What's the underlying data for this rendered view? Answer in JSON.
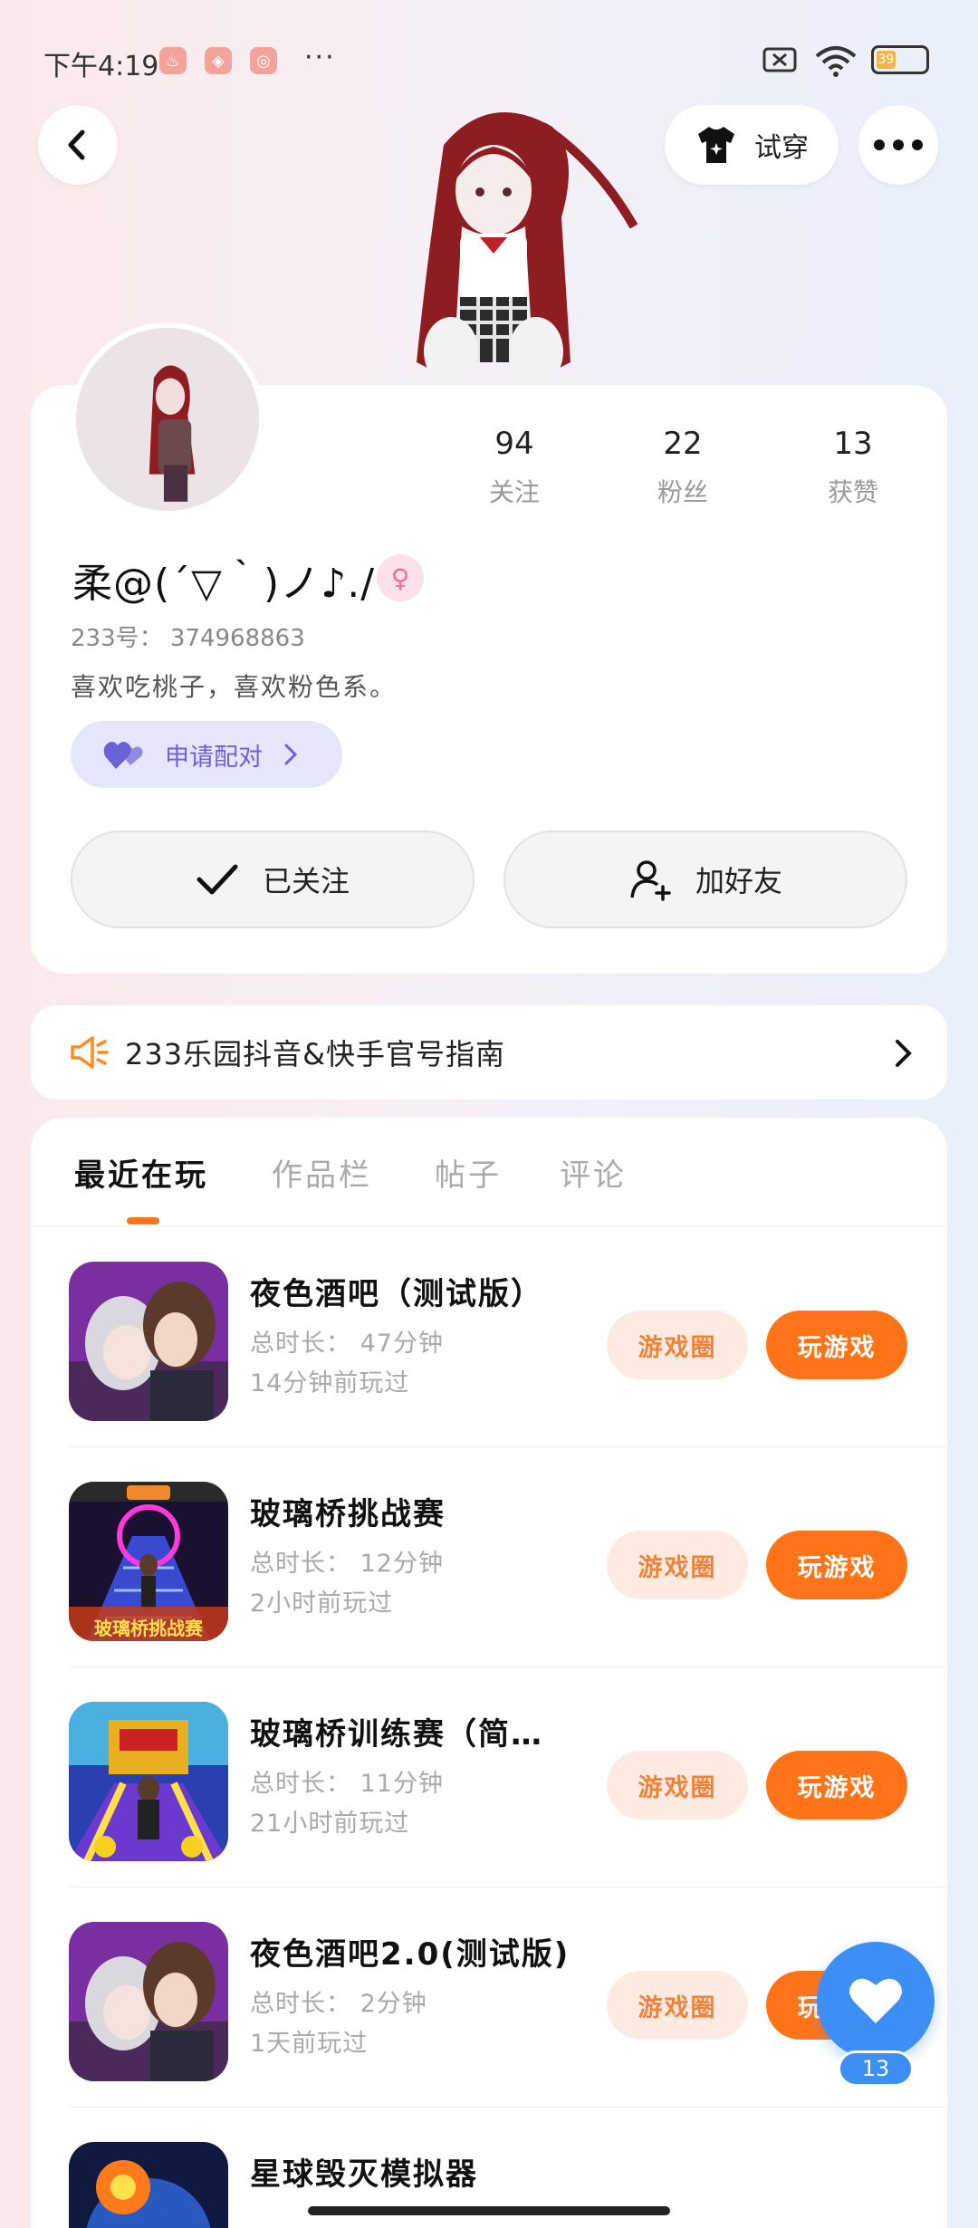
{
  "status_bar": {
    "time": "下午4:19",
    "more": "···",
    "battery": "39",
    "wifi_label": "6"
  },
  "topbar": {
    "tryon_label": "试穿"
  },
  "profile": {
    "nickname": "柔@(´▽｀)ノ♪./",
    "gender_symbol": "♀",
    "uid": "233号： 374968863",
    "bio": "喜欢吃桃子，喜欢粉色系。",
    "pair_label": "申请配对",
    "stats": [
      {
        "value": "94",
        "label": "关注"
      },
      {
        "value": "22",
        "label": "粉丝"
      },
      {
        "value": "13",
        "label": "获赞"
      }
    ],
    "followed_label": "已关注",
    "add_friend_label": "加好友"
  },
  "notice": {
    "text": "233乐园抖音&快手官号指南"
  },
  "tabs": [
    {
      "label": "最近在玩",
      "active": true
    },
    {
      "label": "作品栏",
      "active": false
    },
    {
      "label": "帖子",
      "active": false
    },
    {
      "label": "评论",
      "active": false
    }
  ],
  "games": [
    {
      "name": "夜色酒吧（测试版）",
      "duration": "总时长： 47分钟",
      "last_played": "14分钟前玩过",
      "circle_label": "游戏圈",
      "play_label": "玩游戏"
    },
    {
      "name": "玻璃桥挑战赛",
      "duration": "总时长： 12分钟",
      "last_played": "2小时前玩过",
      "circle_label": "游戏圈",
      "play_label": "玩游戏",
      "icon_text": "玻璃桥挑战赛"
    },
    {
      "name": "玻璃桥训练赛（简…",
      "duration": "总时长： 11分钟",
      "last_played": "21小时前玩过",
      "circle_label": "游戏圈",
      "play_label": "玩游戏"
    },
    {
      "name": "夜色酒吧2.0(测试版)",
      "duration": "总时长： 2分钟",
      "last_played": "1天前玩过",
      "circle_label": "游戏圈",
      "play_label": "玩游戏"
    },
    {
      "name": "星球毁灭模拟器"
    }
  ],
  "floating_like": {
    "count": "13"
  },
  "colors": {
    "accent": "#ff7418",
    "circle_bg": "#fdebe2",
    "like_blue": "#3d8ff5",
    "pair_bg": "#e6e6fb"
  }
}
